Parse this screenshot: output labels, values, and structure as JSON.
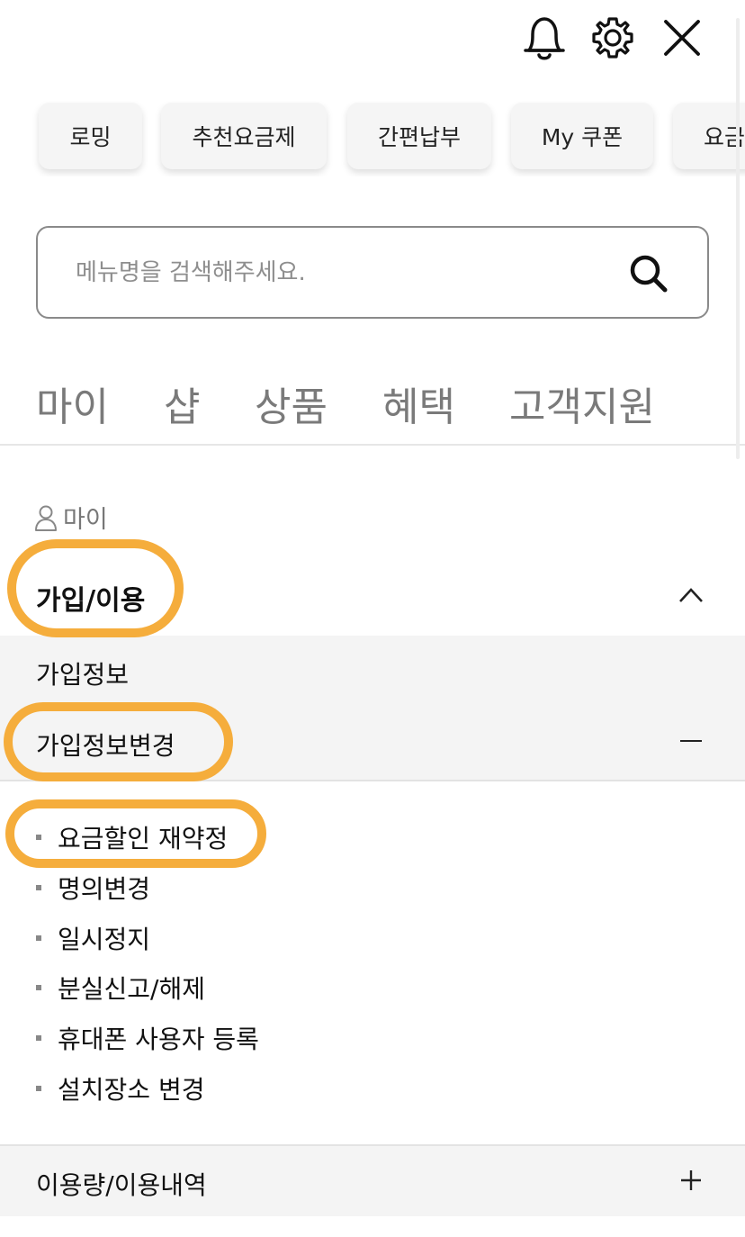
{
  "quick_chips": [
    {
      "label": "로밍"
    },
    {
      "label": "추천요금제"
    },
    {
      "label": "간편납부"
    },
    {
      "label": "My 쿠폰"
    },
    {
      "label": "요금"
    }
  ],
  "search": {
    "placeholder": "메뉴명을 검색해주세요."
  },
  "tabs": [
    {
      "label": "마이"
    },
    {
      "label": "샵"
    },
    {
      "label": "상품"
    },
    {
      "label": "혜택"
    },
    {
      "label": "고객지원"
    }
  ],
  "section": {
    "label": "마이"
  },
  "group": {
    "title": "가입/이용",
    "sub_items": [
      {
        "label": "가입정보"
      },
      {
        "label": "가입정보변경"
      }
    ],
    "leaf_items": [
      {
        "label": "요금할인 재약정"
      },
      {
        "label": "명의변경"
      },
      {
        "label": "일시정지"
      },
      {
        "label": "분실신고/해제"
      },
      {
        "label": "휴대폰 사용자 등록"
      },
      {
        "label": "설치장소 변경"
      }
    ]
  },
  "next_group": {
    "title": "이용량/이용내역"
  },
  "colors": {
    "highlight": "#f5ad3c",
    "tab_text": "#7a7a7a",
    "submenu_bg": "#f4f4f4"
  },
  "icons": [
    "bell-icon",
    "gear-icon",
    "close-icon",
    "search-icon",
    "person-icon",
    "chevron-up-icon",
    "minus-icon",
    "plus-icon"
  ]
}
